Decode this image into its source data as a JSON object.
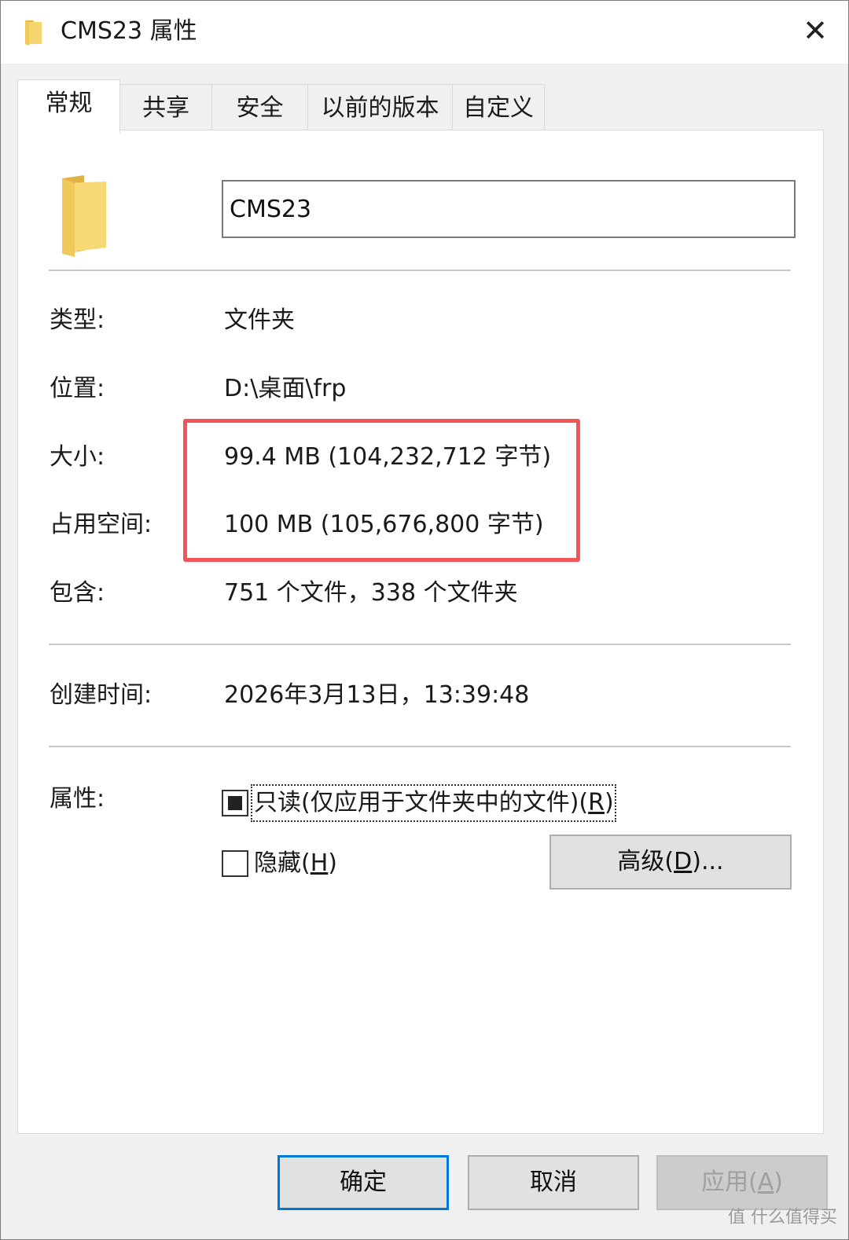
{
  "window": {
    "title": "CMS23 属性",
    "close": "✕"
  },
  "tabs": [
    {
      "label": "常规",
      "active": true
    },
    {
      "label": "共享",
      "active": false
    },
    {
      "label": "安全",
      "active": false
    },
    {
      "label": "以前的版本",
      "active": false
    },
    {
      "label": "自定义",
      "active": false
    }
  ],
  "general": {
    "folder_name": "CMS23",
    "type_label": "类型:",
    "type_value": "文件夹",
    "location_label": "位置:",
    "location_value": "D:\\桌面\\frp",
    "size_label": "大小:",
    "size_value": "99.4 MB (104,232,712 字节)",
    "size_on_disk_label": "占用空间:",
    "size_on_disk_value": "100 MB (105,676,800 字节)",
    "contains_label": "包含:",
    "contains_value": "751 个文件，338 个文件夹",
    "created_label": "创建时间:",
    "created_value": "2026年3月13日，13:39:48",
    "attributes_label": "属性:",
    "readonly_text": "只读(仅应用于文件夹中的文件)(",
    "readonly_key": "R",
    "readonly_close": ")",
    "readonly_state": "indeterminate",
    "hidden_text": "隐藏(",
    "hidden_key": "H",
    "hidden_close": ")",
    "hidden_checked": false,
    "advanced_text": "高级(",
    "advanced_key": "D",
    "advanced_close": ")..."
  },
  "buttons": {
    "ok": "确定",
    "cancel": "取消",
    "apply_text": "应用(",
    "apply_key": "A",
    "apply_close": ")"
  },
  "watermark": "值 什么值得买",
  "colors": {
    "highlight": "#f25458",
    "default_button": "#0078d7",
    "folder": "#f2cf66"
  },
  "icons": {
    "folder": "folder-icon",
    "close": "close-icon"
  }
}
